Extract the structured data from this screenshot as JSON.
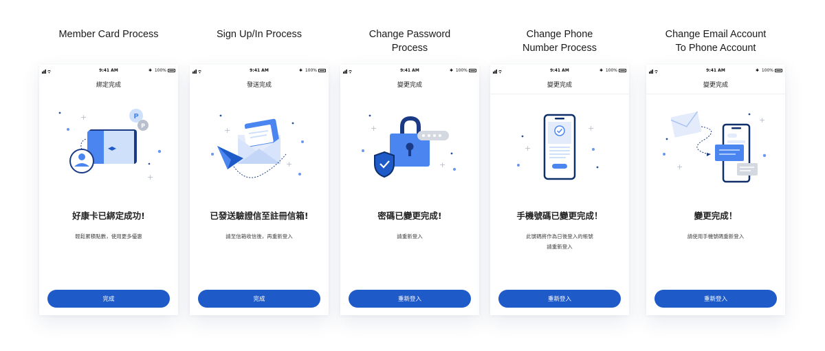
{
  "status_bar": {
    "time": "9:41 AM",
    "battery": "100%",
    "bluetooth": "✱"
  },
  "colors": {
    "primary": "#1f5ac9",
    "accent": "#4b86f0",
    "light": "#d7e4fb",
    "dark": "#0f2f6b"
  },
  "screens": [
    {
      "column_title": [
        "Member Card Process"
      ],
      "nav_title": "綁定完成",
      "icons": [
        "member-card-icon",
        "avatar-icon",
        "points-badge-icon"
      ],
      "brand_glyph": "◂▸",
      "headline": "好康卡已綁定成功!",
      "description": [
        "輕鬆累積點數，使用更多優惠"
      ],
      "button_label": "完成"
    },
    {
      "column_title": [
        "Sign Up/In Process"
      ],
      "nav_title": "發送完成",
      "icons": [
        "paper-plane-icon",
        "envelope-icon"
      ],
      "headline": "已發送驗證信至註冊信箱!",
      "description": [
        "請至信箱收信後，再重新登入"
      ],
      "button_label": "完成"
    },
    {
      "column_title": [
        "Change Password",
        "Process"
      ],
      "nav_title": "變更完成",
      "icons": [
        "padlock-icon",
        "shield-check-icon",
        "password-dots-icon"
      ],
      "headline": "密碼已變更完成!",
      "description": [
        "請重新登入"
      ],
      "button_label": "重新登入"
    },
    {
      "column_title": [
        "Change Phone",
        "Number Process"
      ],
      "nav_title": "變更完成",
      "icons": [
        "smartphone-check-icon"
      ],
      "headline": "手機號碼已變更完成！",
      "description": [
        "此號碼將作為日後登入的帳號",
        "請重新登入"
      ],
      "button_label": "重新登入"
    },
    {
      "column_title": [
        "Change Email Account",
        "To Phone Account"
      ],
      "nav_title": "變更完成",
      "icons": [
        "email-icon",
        "smartphone-icon",
        "chat-bubble-icon"
      ],
      "headline": "變更完成！",
      "description": [
        "請使用手機號碼重新登入"
      ],
      "button_label": "重新登入"
    }
  ]
}
